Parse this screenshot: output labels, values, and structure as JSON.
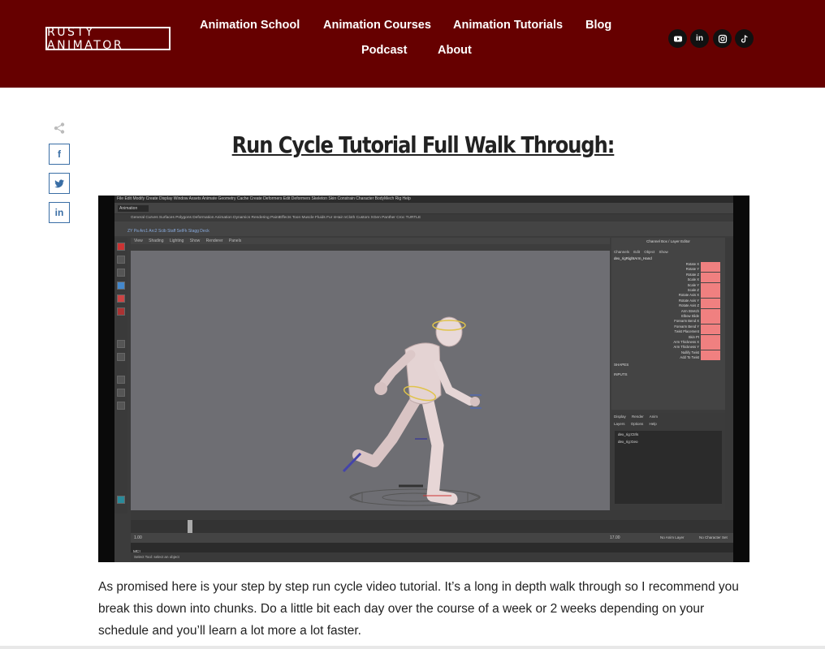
{
  "brand": {
    "logo_text": "RUSTY ANIMATOR"
  },
  "nav": {
    "items": [
      {
        "label": "Animation School"
      },
      {
        "label": "Animation Courses"
      },
      {
        "label": "Animation Tutorials"
      },
      {
        "label": "Blog"
      },
      {
        "label": "Podcast"
      },
      {
        "label": "About"
      }
    ]
  },
  "social": {
    "icons": [
      "youtube-icon",
      "linkedin-icon",
      "instagram-icon",
      "tiktok-icon"
    ],
    "linkedin_text": "in"
  },
  "share": {
    "toggle_icon": "share-icon",
    "facebook": "f",
    "linkedin": "in"
  },
  "post": {
    "title": "Run Cycle Tutorial Full Walk Through:",
    "body": "As promised here is your step by step run cycle video tutorial. It’s a long in depth walk through so I recommend you break this down into chunks. Do a little bit each day over the course of a week or 2 weeks depending on your schedule and you’ll learn a lot more a lot faster."
  },
  "maya": {
    "menubar": "File   Edit   Modify   Create   Display   Window   Assets   Animate   Geometry Cache   Create Deformers   Edit Deformers   Skeleton   Skin   Constrain   Character   BodyMech Rig   Help",
    "mode": "Animation",
    "shelf_tabs": "General   Curves   Surfaces   Polygons   Deformation   Animation   Dynamics   Rendering   PaintEffects   Toon   Muscle   Fluids   Fur   nHair   nCloth   Custom   XGen   Panther   Croc   TURTLE",
    "shelf_labels": "ZY Pa   Arc1   Arc2   Scib   Staff   SelFk   Stagg   Deck",
    "panel_menu": "View Shading Lighting Show Renderer Panels",
    "channel_box_title": "Channel Box / Layer Editor",
    "channel_box_menu": "Channels  Edit  Object  Show",
    "node_name": "dex_rigRightArm_Hand",
    "channels": [
      "Rotate X",
      "Rotate Y",
      "Rotate Z",
      "Scale X",
      "Scale Y",
      "Scale Z",
      "Rotate Axis X",
      "Rotate Axis Y",
      "Rotate Axis Z",
      "Arm Stretch",
      "Elbow Slide",
      "Forearm Bend X",
      "Forearm Bend Y",
      "Twist Placement",
      "Skin Pt",
      "Arm Thickness X",
      "Arm Thickness Y",
      "Nullify Twist",
      "Add To Twist"
    ],
    "shapes_label": "SHAPES",
    "inputs_label": "INPUTS",
    "layer_tabs": "Display  Render  Anim",
    "layer_menu": "Layers  Options  Help",
    "layers": [
      "dex_rig:Ctrls",
      "dex_rig:Geo"
    ],
    "mel_label": "MEL",
    "help_line": "Select Tool: select an object",
    "current_frame": "3",
    "range_start": "1.00",
    "range_end": "17.00",
    "anim_layer": "No Anim Layer",
    "character_set": "No Character Set"
  },
  "colors": {
    "header_bg": "#660000",
    "accent_blue": "#3a6ea5",
    "channel_key": "#f08080",
    "viewport_bg": "#6e6e73"
  }
}
